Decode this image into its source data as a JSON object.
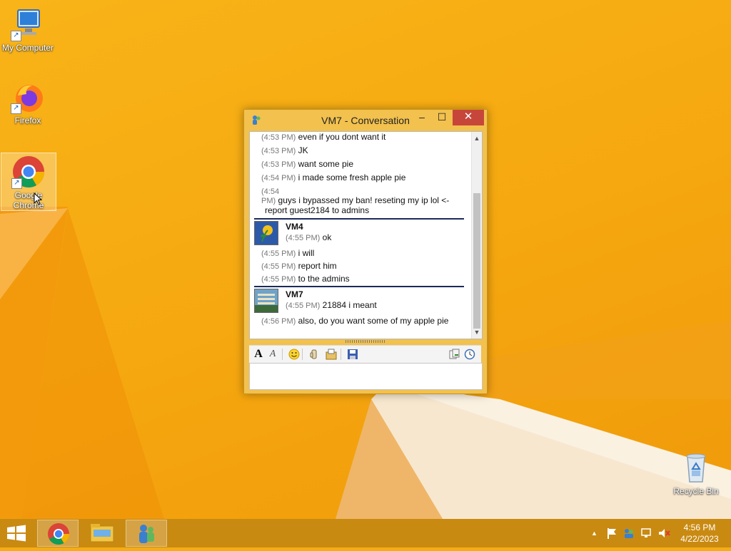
{
  "desktop": {
    "icons": [
      {
        "label": "My Computer"
      },
      {
        "label": "Firefox"
      },
      {
        "label": "Google Chrome"
      },
      {
        "label": "Recycle Bin"
      }
    ]
  },
  "window": {
    "title": "VM7 - Conversation",
    "buttons": {
      "minimize": "–",
      "maximize": "☐",
      "close": "✕"
    }
  },
  "conversation": {
    "lines": [
      {
        "time": "(4:53 PM)",
        "text": "even if you dont want it"
      },
      {
        "time": "(4:53 PM)",
        "text": "JK"
      },
      {
        "time": "(4:53 PM)",
        "text": "want some pie"
      },
      {
        "time": "(4:54 PM)",
        "text": "i made some fresh apple pie"
      },
      {
        "time_a": "(4:54",
        "time_b": "PM)",
        "text_a": "guys i bypassed my ban! reseting my ip lol <-",
        "text_b": "report guest2184 to admins"
      }
    ],
    "block1": {
      "sender": "VM4",
      "first": {
        "time": "(4:55 PM)",
        "text": "ok"
      },
      "lines": [
        {
          "time": "(4:55 PM)",
          "text": "i will"
        },
        {
          "time": "(4:55 PM)",
          "text": "report him"
        },
        {
          "time": "(4:55 PM)",
          "text": "to the admins"
        }
      ]
    },
    "block2": {
      "sender": "VM7",
      "first": {
        "time": "(4:55 PM)",
        "text": "21884 i meant"
      },
      "lines": [
        {
          "time": "(4:56 PM)",
          "text": "also, do you want some of my apple pie"
        }
      ]
    }
  },
  "toolbar": {
    "icons": [
      "font-icon",
      "font-style-icon",
      "emoticon-icon",
      "nudge-icon",
      "send-file-icon",
      "save-icon",
      "send-to-icon",
      "history-icon"
    ]
  },
  "taskbar": {
    "clock_time": "4:56 PM",
    "clock_date": "4/22/2023",
    "tray_chevron": "▲"
  }
}
